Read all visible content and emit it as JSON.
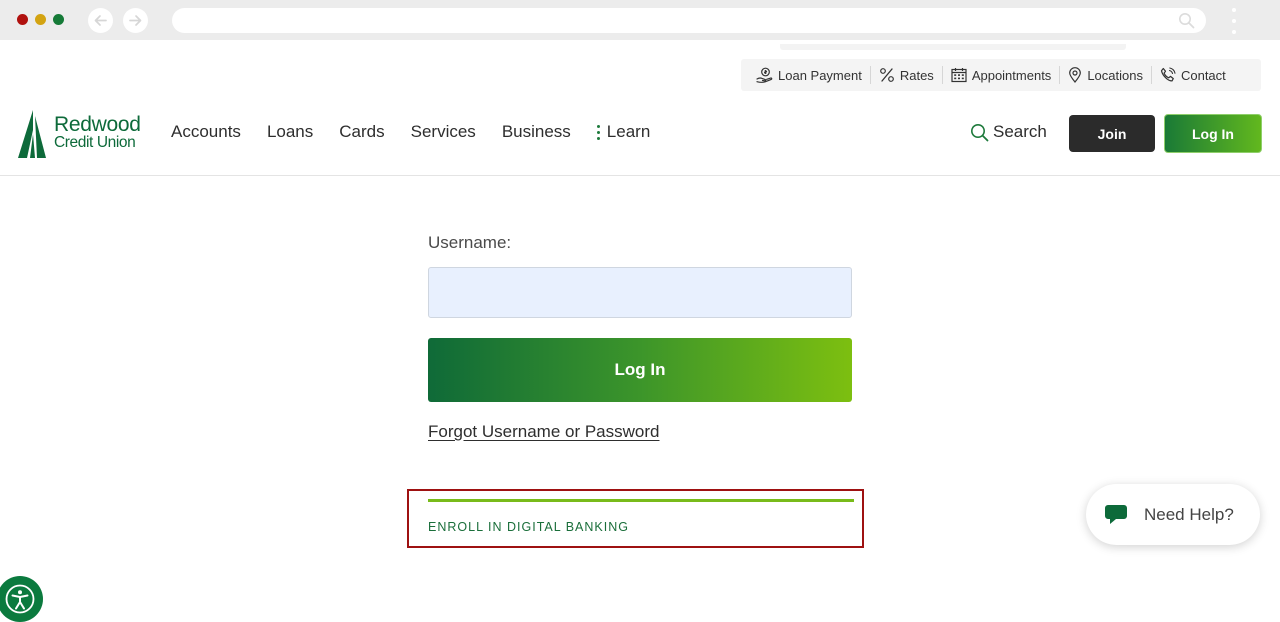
{
  "browser": {
    "url": ""
  },
  "utility_nav": [
    {
      "label": "Loan Payment",
      "icon": "hand-dollar-icon"
    },
    {
      "label": "Rates",
      "icon": "percent-icon"
    },
    {
      "label": "Appointments",
      "icon": "calendar-icon"
    },
    {
      "label": "Locations",
      "icon": "map-pin-icon"
    },
    {
      "label": "Contact",
      "icon": "phone-icon"
    }
  ],
  "brand": {
    "line1": "Redwood",
    "line2": "Credit Union",
    "color": "#0d6a3a"
  },
  "main_nav": [
    "Accounts",
    "Loans",
    "Cards",
    "Services",
    "Business",
    "Learn"
  ],
  "header_actions": {
    "search": "Search",
    "join": "Join",
    "login": "Log In"
  },
  "login_form": {
    "username_label": "Username:",
    "username_value": "",
    "submit": "Log In",
    "forgot": "Forgot Username or Password",
    "enroll": "ENROLL IN DIGITAL BANKING"
  },
  "help_widget": {
    "label": "Need Help?"
  },
  "colors": {
    "accent_green": "#0f6a38",
    "lime": "#7dbf10",
    "highlight_border": "#9e1111"
  }
}
